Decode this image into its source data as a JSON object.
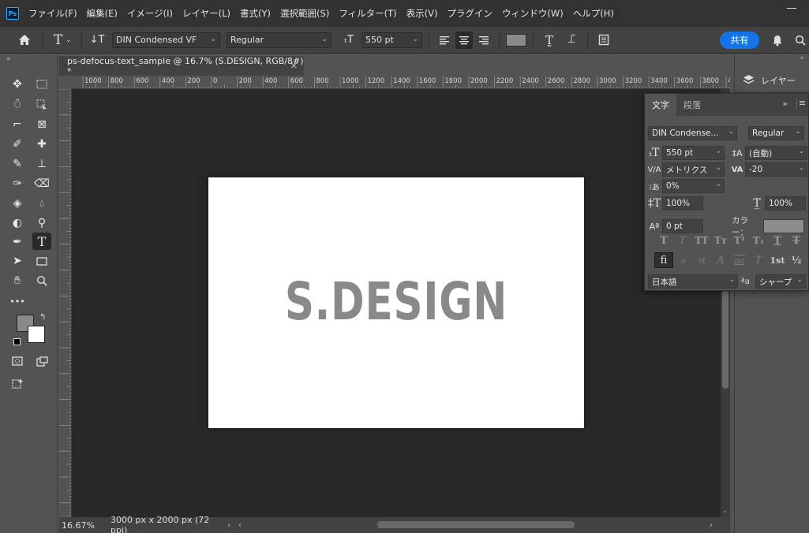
{
  "app": {
    "logo": "Ps"
  },
  "menu": [
    "ファイル(F)",
    "編集(E)",
    "イメージ(I)",
    "レイヤー(L)",
    "書式(Y)",
    "選択範囲(S)",
    "フィルター(T)",
    "表示(V)",
    "プラグイン",
    "ウィンドウ(W)",
    "ヘルプ(H)"
  ],
  "options": {
    "font_family": "DIN Condensed VF",
    "font_style": "Regular",
    "font_size": "550 pt",
    "share_label": "共有",
    "text_color": "#8a8a8a"
  },
  "document": {
    "tab_title": "ps-defocus-text_sample @ 16.7% (S.DESIGN, RGB/8#) *",
    "canvas_text": "S.DESIGN",
    "canvas_text_color": "#898989"
  },
  "ruler": {
    "top_ticks": [
      "1000",
      "800",
      "600",
      "400",
      "200",
      "0",
      "200",
      "400",
      "600",
      "800",
      "1000",
      "1200",
      "1400",
      "1600",
      "1800",
      "2000",
      "2200",
      "2400",
      "2600",
      "2800",
      "3000",
      "3200",
      "3400",
      "3600",
      "3800",
      "400"
    ]
  },
  "status": {
    "zoom": "16.67%",
    "doc_info": "3000 px x 2000 px (72 ppi)"
  },
  "layers_panel": {
    "title": "レイヤー"
  },
  "character_panel": {
    "tabs": [
      "文字",
      "段落"
    ],
    "font_family": "DIN Condense...",
    "font_style": "Regular",
    "font_size": "550 pt",
    "leading": "(自動)",
    "kerning": "メトリクス",
    "tracking": "-20",
    "tsume": "0%",
    "vertical_scale": "100%",
    "horizontal_scale": "100%",
    "baseline_shift": "0 pt",
    "color_label": "カラー：",
    "color_value": "#8c8c8c",
    "language": "日本語",
    "antialias_label": "ªa",
    "antialias": "シャープ",
    "type_styles": [
      "T",
      "T",
      "TT",
      "Tт",
      "T¹",
      "T₁",
      "T",
      "T"
    ],
    "opentype": [
      "fi",
      "ℴ",
      "st",
      "A",
      "aa",
      "T",
      "1st",
      "½"
    ]
  }
}
